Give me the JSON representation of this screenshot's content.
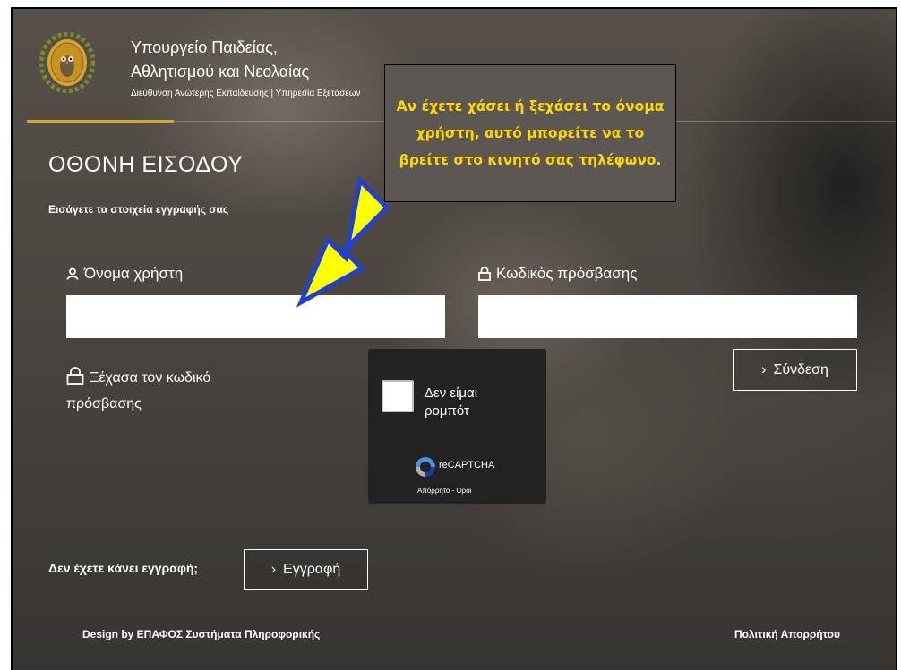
{
  "header": {
    "ministry_line1": "Υπουργείο Παιδείας,",
    "ministry_line2": "Αθλητισμού και Νεολαίας",
    "ministry_line3": "Διεύθυνση Ανώτερης Εκπαίδευσης | Υπηρεσία Εξετάσεων",
    "accent_color": "#d8a52b"
  },
  "login": {
    "title": "ΟΘΟΝΗ ΕΙΣΟΔΟΥ",
    "subtitle": "Εισάγετε τα στοιχεία εγγραφής σας",
    "username_label": "Όνομα χρήστη",
    "username_value": "",
    "password_label": "Κωδικός πρόσβασης",
    "password_value": "",
    "forgot_label": "Ξέχασα τον κωδικό πρόσβασης",
    "login_button": "Σύνδεση"
  },
  "callout": {
    "text": "Αν έχετε χάσει ή ξεχάσει το όνομα χρήστη, αυτό μπορείτε να το βρείτε στο κινητό σας τηλέφωνο.",
    "text_color": "#ffd800",
    "arrow_color": "#ffff00"
  },
  "captcha": {
    "label": "Δεν είμαι ρομπότ",
    "brand": "reCAPTCHA",
    "links": "Απόρρητο - Όροι"
  },
  "register": {
    "prompt": "Δεν έχετε κάνει εγγραφή;",
    "button": "Εγγραφή"
  },
  "footer": {
    "credit": "Design by ΕΠΑΦΟΣ Συστήματα Πληροφορικής",
    "privacy": "Πολιτική Απορρήτου"
  }
}
